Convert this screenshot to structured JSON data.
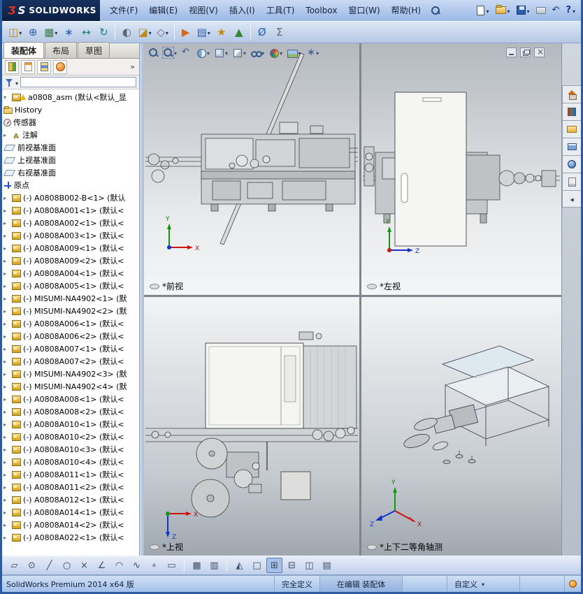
{
  "titlebar": {
    "logo": {
      "mark_red": "Ʒ",
      "mark_white": "S",
      "brand": "SOLIDWORKS"
    },
    "menus": [
      {
        "name": "menu-file",
        "label": "文件(F)"
      },
      {
        "name": "menu-edit",
        "label": "编辑(E)"
      },
      {
        "name": "menu-view",
        "label": "视图(V)"
      },
      {
        "name": "menu-insert",
        "label": "插入(I)"
      },
      {
        "name": "menu-tools",
        "label": "工具(T)"
      },
      {
        "name": "menu-toolbox",
        "label": "Toolbox"
      },
      {
        "name": "menu-window",
        "label": "窗口(W)"
      },
      {
        "name": "menu-help",
        "label": "帮助(H)"
      }
    ],
    "quick_icons": [
      {
        "name": "new-document-icon",
        "kind": "new",
        "chev": true
      },
      {
        "name": "open-icon",
        "kind": "open",
        "chev": true
      },
      {
        "name": "save-icon",
        "kind": "save",
        "chev": true
      },
      {
        "name": "print-icon",
        "kind": "print",
        "chev": false
      },
      {
        "name": "undo-icon",
        "kind": "undo",
        "chev": false
      },
      {
        "name": "help-icon",
        "kind": "help",
        "chev": true
      }
    ]
  },
  "assembly_toolbar": {
    "icons": [
      {
        "name": "insert-components-icon",
        "glyph": "◫",
        "color": "gold",
        "chev": true
      },
      {
        "name": "mate-icon",
        "glyph": "⊕",
        "color": "blue"
      },
      {
        "name": "linear-component-pattern-icon",
        "glyph": "▦",
        "color": "green",
        "chev": true
      },
      {
        "name": "smart-fasteners-icon",
        "glyph": "∗",
        "color": "blue"
      },
      {
        "name": "move-component-icon",
        "glyph": "↔",
        "color": "teal"
      },
      {
        "name": "rotate-component-icon",
        "glyph": "↻",
        "color": "teal"
      },
      {
        "sep": true
      },
      {
        "name": "show-hidden-components-icon",
        "glyph": "◐",
        "color": "grey"
      },
      {
        "name": "assembly-features-icon",
        "glyph": "◪",
        "color": "gold",
        "chev": true
      },
      {
        "name": "reference-geometry-icon",
        "glyph": "◇",
        "color": "slate",
        "chev": true
      },
      {
        "sep": true
      },
      {
        "name": "new-motion-study-icon",
        "glyph": "▶",
        "color": "orange"
      },
      {
        "name": "bill-of-materials-icon",
        "glyph": "▤",
        "color": "blue",
        "chev": true
      },
      {
        "name": "exploded-view-icon",
        "glyph": "★",
        "color": "gold"
      },
      {
        "name": "instant3d-icon",
        "glyph": "▲",
        "color": "green"
      },
      {
        "sep": true
      },
      {
        "name": "measure-icon",
        "glyph": "Ø",
        "color": "blue"
      },
      {
        "name": "mass-properties-icon",
        "glyph": "Σ",
        "color": "grey"
      }
    ]
  },
  "left_panel": {
    "tabs": [
      {
        "name": "assembly-tab",
        "label": "装配体",
        "state": "active"
      },
      {
        "name": "layout-tab",
        "label": "布局"
      },
      {
        "name": "sketch-tab",
        "label": "草图"
      }
    ],
    "manager_tabs": [
      {
        "name": "featuremanager-tab-icon",
        "cls": "fm"
      },
      {
        "name": "propertymanager-tab-icon",
        "cls": "pm"
      },
      {
        "name": "configurationmanager-tab-icon",
        "cls": "cm"
      },
      {
        "name": "displaymanager-tab-icon",
        "cls": "dm"
      }
    ],
    "filter": {
      "placeholder": ""
    },
    "tree": {
      "root": {
        "label": "a0808_asm (默认<默认_显"
      },
      "items": [
        {
          "icon": "history",
          "label": "History"
        },
        {
          "icon": "sensors",
          "label": "传感器"
        },
        {
          "icon": "annotations",
          "label": "注解",
          "arrow": true
        },
        {
          "icon": "plane",
          "label": "前视基准面"
        },
        {
          "icon": "plane",
          "label": "上视基准面"
        },
        {
          "icon": "plane",
          "label": "右视基准面"
        },
        {
          "icon": "origin",
          "label": "原点"
        },
        {
          "icon": "component",
          "arrow": true,
          "label": "(-) A0808B002-B<1> (默认"
        },
        {
          "icon": "component",
          "arrow": true,
          "label": "(-) A0808A001<1> (默认<"
        },
        {
          "icon": "component",
          "arrow": true,
          "label": "(-) A0808A002<1> (默认<"
        },
        {
          "icon": "component",
          "arrow": true,
          "label": "(-) A0808A003<1> (默认<"
        },
        {
          "icon": "component",
          "arrow": true,
          "label": "(-) A0808A009<1> (默认<"
        },
        {
          "icon": "component",
          "arrow": true,
          "label": "(-) A0808A009<2> (默认<"
        },
        {
          "icon": "component",
          "arrow": true,
          "label": "(-) A0808A004<1> (默认<"
        },
        {
          "icon": "component",
          "arrow": true,
          "label": "(-) A0808A005<1> (默认<"
        },
        {
          "icon": "component",
          "arrow": true,
          "label": "(-) MISUMI-NA4902<1> (默"
        },
        {
          "icon": "component",
          "arrow": true,
          "label": "(-) MISUMI-NA4902<2> (默"
        },
        {
          "icon": "component",
          "arrow": true,
          "label": "(-) A0808A006<1> (默认<"
        },
        {
          "icon": "component",
          "arrow": true,
          "label": "(-) A0808A006<2> (默认<"
        },
        {
          "icon": "component",
          "arrow": true,
          "label": "(-) A0808A007<1> (默认<"
        },
        {
          "icon": "component",
          "arrow": true,
          "label": "(-) A0808A007<2> (默认<"
        },
        {
          "icon": "component",
          "arrow": true,
          "label": "(-) MISUMI-NA4902<3> (默"
        },
        {
          "icon": "component",
          "arrow": true,
          "label": "(-) MISUMI-NA4902<4> (默"
        },
        {
          "icon": "component",
          "arrow": true,
          "label": "(-) A0808A008<1> (默认<"
        },
        {
          "icon": "component",
          "arrow": true,
          "label": "(-) A0808A008<2> (默认<"
        },
        {
          "icon": "component",
          "arrow": true,
          "label": "(-) A0808A010<1> (默认<"
        },
        {
          "icon": "component",
          "arrow": true,
          "label": "(-) A0808A010<2> (默认<"
        },
        {
          "icon": "component",
          "arrow": true,
          "label": "(-) A0808A010<3> (默认<"
        },
        {
          "icon": "component",
          "arrow": true,
          "label": "(-) A0808A010<4> (默认<"
        },
        {
          "icon": "component",
          "arrow": true,
          "label": "(-) A0808A011<1> (默认<"
        },
        {
          "icon": "component",
          "arrow": true,
          "label": "(-) A0808A011<2> (默认<"
        },
        {
          "icon": "component",
          "arrow": true,
          "label": "(-) A0808A012<1> (默认<"
        },
        {
          "icon": "component",
          "arrow": true,
          "label": "(-) A0808A014<1> (默认<"
        },
        {
          "icon": "component",
          "arrow": true,
          "label": "(-) A0808A014<2> (默认<"
        },
        {
          "icon": "component",
          "arrow": true,
          "label": "(-) A0808A022<1> (默认<"
        }
      ]
    }
  },
  "viewport": {
    "headsup": [
      {
        "name": "zoom-fit-icon",
        "cls": "zoomfit"
      },
      {
        "name": "zoom-area-icon",
        "cls": "zoomarea",
        "chev": true
      },
      {
        "name": "previous-view-icon",
        "cls": "prevview"
      },
      {
        "name": "section-view-icon",
        "cls": "section",
        "chev": true
      },
      {
        "name": "view-orientation-icon",
        "cls": "vieworient",
        "chev": true
      },
      {
        "name": "display-style-icon",
        "cls": "displaystyle",
        "chev": true
      },
      {
        "name": "hide-show-icon",
        "cls": "hideshow",
        "chev": true
      },
      {
        "name": "edit-appearance-icon",
        "cls": "appearance",
        "chev": true
      },
      {
        "name": "apply-scene-icon",
        "cls": "scene",
        "chev": true
      },
      {
        "name": "view-settings-icon",
        "cls": "viewsettings",
        "chev": true
      }
    ],
    "window_buttons": [
      {
        "name": "pane-minimize-button",
        "cls": "minimize"
      },
      {
        "name": "pane-restore-button",
        "cls": "restore"
      },
      {
        "name": "pane-close-button",
        "cls": "close"
      }
    ],
    "panes": [
      {
        "label": "*前视",
        "axes": {
          "up": "Y",
          "right": "X"
        }
      },
      {
        "label": "*左视",
        "axes": {
          "up": "Y",
          "right": "Z"
        }
      },
      {
        "label": "*上视",
        "axes": {
          "right": "X",
          "down": "Z"
        }
      },
      {
        "label": "*上下二等角轴测",
        "axes": {
          "up": "Y",
          "se": "X",
          "sw": "Z"
        }
      }
    ]
  },
  "task_pane": {
    "icons": [
      {
        "name": "task-home-icon",
        "cls": "home"
      },
      {
        "name": "design-library-icon",
        "cls": "library"
      },
      {
        "name": "file-explorer-icon",
        "cls": "explorer"
      },
      {
        "name": "view-palette-icon",
        "cls": "palette"
      },
      {
        "name": "appearances-icon",
        "cls": "sphere"
      },
      {
        "name": "custom-properties-icon",
        "cls": "props"
      },
      {
        "name": "task-pane-collapse-icon",
        "cls": "collapse"
      }
    ]
  },
  "sketch_toolbar": {
    "icons": [
      {
        "name": "sketch-icon",
        "glyph": "▱"
      },
      {
        "name": "smart-dimension-icon",
        "glyph": "⊙"
      },
      {
        "name": "line-icon",
        "glyph": "╱"
      },
      {
        "name": "circle-icon",
        "glyph": "○"
      },
      {
        "name": "trim-entities-icon",
        "glyph": "×"
      },
      {
        "name": "centerline-icon",
        "glyph": "∠"
      },
      {
        "name": "arc-icon",
        "glyph": "◠"
      },
      {
        "name": "spline-icon",
        "glyph": "∿"
      },
      {
        "name": "point-icon",
        "glyph": "∘"
      },
      {
        "name": "rectangle-icon",
        "glyph": "▭"
      },
      {
        "sep": true
      },
      {
        "name": "grid-icon",
        "glyph": "▦"
      },
      {
        "name": "snap-icon",
        "glyph": "▥"
      },
      {
        "sep": true
      },
      {
        "name": "normal-to-icon",
        "glyph": "◭"
      },
      {
        "name": "single-view-icon",
        "glyph": "□"
      },
      {
        "name": "four-view-icon",
        "glyph": "⊞",
        "state": "active"
      },
      {
        "name": "two-view-horizontal-icon",
        "glyph": "⊟"
      },
      {
        "name": "two-view-vertical-icon",
        "glyph": "◫"
      },
      {
        "name": "link-views-icon",
        "glyph": "▤"
      }
    ]
  },
  "status_bar": {
    "app_info": "SolidWorks Premium 2014 x64 版",
    "defined": "完全定义",
    "editing": "在编辑 装配体",
    "custom": "自定义"
  }
}
